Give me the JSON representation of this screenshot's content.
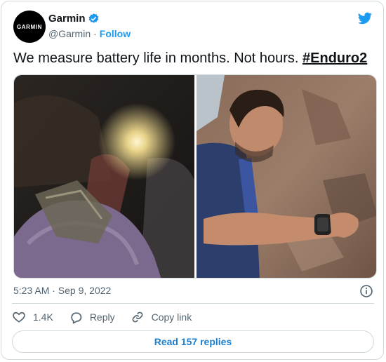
{
  "author": {
    "avatar_text": "GARMIN",
    "name": "Garmin",
    "handle": "@Garmin",
    "separator": "·",
    "follow_label": "Follow"
  },
  "tweet": {
    "text": "We measure battery life in months. Not hours. ",
    "hashtag": "#Enduro2"
  },
  "meta": {
    "timestamp": "5:23 AM · Sep 9, 2022"
  },
  "actions": {
    "like_count": "1.4K",
    "reply_label": "Reply",
    "copy_link_label": "Copy link"
  },
  "replies_button_label": "Read 157 replies",
  "colors": {
    "accent": "#1d9bf0",
    "text_secondary": "#536471",
    "border": "#cfd9de"
  }
}
